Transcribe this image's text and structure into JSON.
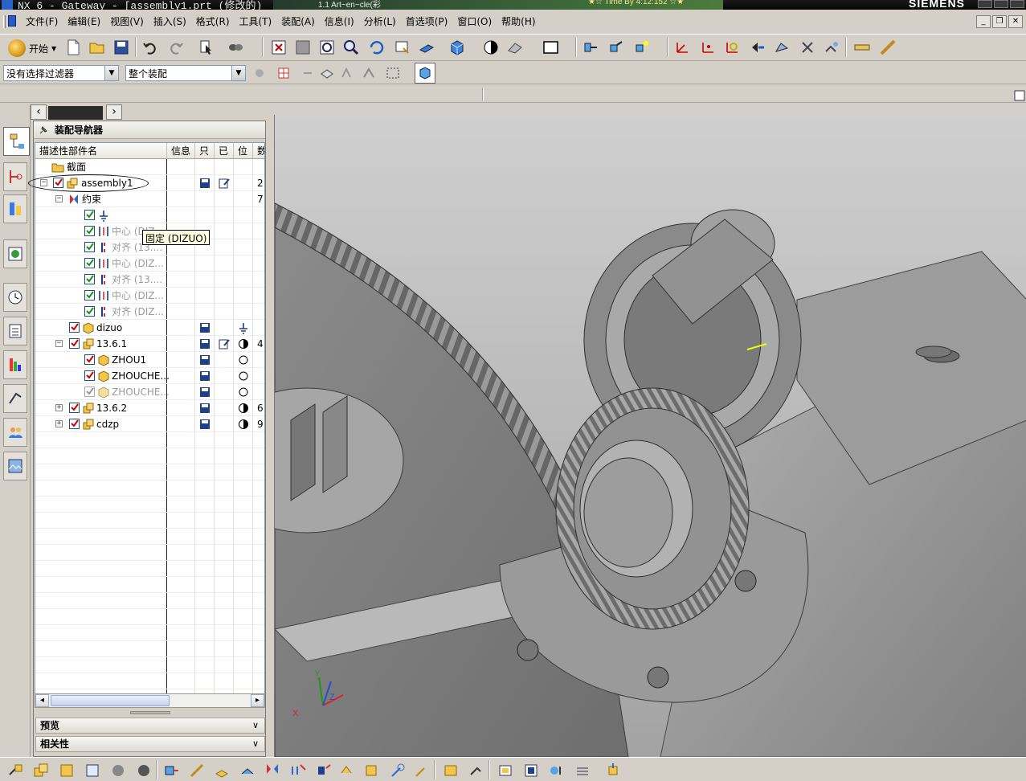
{
  "window": {
    "title": "NX 6 - Gateway - [assembly1.prt  (修改的)",
    "overlay_text": "1.1 Art~en~cle(彩",
    "timer_text": "★☆ Time By 4:12:152 ☆★",
    "brand": "SIEMENS"
  },
  "menubar": {
    "items": [
      "文件(F)",
      "编辑(E)",
      "视图(V)",
      "插入(S)",
      "格式(R)",
      "工具(T)",
      "装配(A)",
      "信息(I)",
      "分析(L)",
      "首选项(P)",
      "窗口(O)",
      "帮助(H)"
    ]
  },
  "toolbar": {
    "start_label": "开始",
    "filter_value": "没有选择过滤器",
    "scope_value": "整个装配"
  },
  "navigator": {
    "title": "装配导航器",
    "columns": [
      "描述性部件名",
      "信息",
      "只",
      "已",
      "位",
      "数"
    ],
    "rows": [
      {
        "name": "截面",
        "dim": false,
        "num": ""
      },
      {
        "name": "assembly1",
        "dim": false,
        "num": "2"
      },
      {
        "name": "约束",
        "dim": false,
        "num": "7"
      },
      {
        "name": "固定 (DIZUO)",
        "dim": false,
        "num": ""
      },
      {
        "name": "中心 (DIZ...",
        "dim": true,
        "num": ""
      },
      {
        "name": "对齐 (13....",
        "dim": true,
        "num": ""
      },
      {
        "name": "中心 (DIZ...",
        "dim": true,
        "num": ""
      },
      {
        "name": "对齐 (13....",
        "dim": true,
        "num": ""
      },
      {
        "name": "中心 (DIZ...",
        "dim": true,
        "num": ""
      },
      {
        "name": "对齐 (DIZ...",
        "dim": true,
        "num": ""
      },
      {
        "name": "dizuo",
        "dim": false,
        "num": ""
      },
      {
        "name": "13.6.1",
        "dim": false,
        "num": "4"
      },
      {
        "name": "ZHOU1",
        "dim": false,
        "num": ""
      },
      {
        "name": "ZHOUCHE...",
        "dim": false,
        "num": ""
      },
      {
        "name": "ZHOUCHE...",
        "dim": true,
        "num": ""
      },
      {
        "name": "13.6.2",
        "dim": false,
        "num": "6"
      },
      {
        "name": "cdzp",
        "dim": false,
        "num": "9"
      }
    ],
    "tooltip": "固定 (DIZUO)",
    "sections": [
      "预览",
      "相关性"
    ]
  },
  "viewport": {
    "axis_labels": [
      "Z",
      "X",
      "Y"
    ]
  },
  "colors": {
    "check_red": "#d00000",
    "check_green": "#1d8e1d",
    "tooltip_bg": "#ffffe1",
    "panel_bg": "#d4d0c8"
  }
}
